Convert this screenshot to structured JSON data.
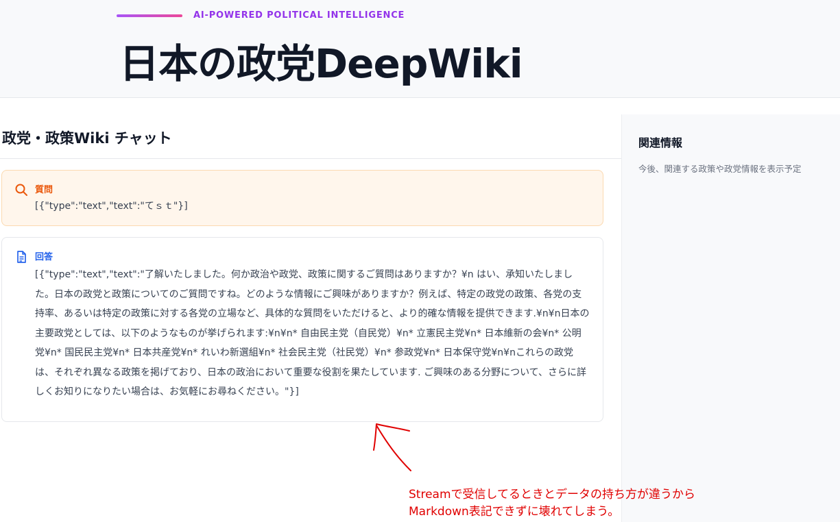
{
  "header": {
    "tagline": "AI-POWERED POLITICAL INTELLIGENCE",
    "title": "日本の政党DeepWiki"
  },
  "chat": {
    "title": "政党・政策Wiki チャット",
    "question": {
      "label": "質問",
      "icon": "search-icon",
      "text": "[{\"type\":\"text\",\"text\":\"てｓｔ\"}]"
    },
    "answer": {
      "label": "回答",
      "icon": "document-icon",
      "text": "[{\"type\":\"text\",\"text\":\"了解いたしました。何か政治や政党、政策に関するご質問はありますか？¥n はい、承知いたしました。日本の政党と政策についてのご質問ですね。どのような情報にご興味がありますか？例えば、特定の政党の政策、各党の支持率、あるいは特定の政策に対する各党の立場など、具体的な質問をいただけると、より的確な情報を提供できます.¥n¥n日本の主要政党としては、以下のようなものが挙げられます:¥n¥n* 自由民主党（自民党）¥n* 立憲民主党¥n* 日本維新の会¥n* 公明党¥n* 国民民主党¥n* 日本共産党¥n* れいわ新選組¥n* 社会民主党（社民党）¥n* 参政党¥n* 日本保守党¥n¥nこれらの政党は、それぞれ異なる政策を掲げており、日本の政治において重要な役割を果たしています. ご興味のある分野について、さらに詳しくお知りになりたい場合は、お気軽にお尋ねください。\"}]"
    }
  },
  "sidebar": {
    "title": "関連情報",
    "description": "今後、関連する政策や政党情報を表示予定"
  },
  "annotation": {
    "line1": "Streamで受信してるときとデータの持ち方が違うから",
    "line2": "Markdown表記できずに壊れてしまう。",
    "color": "#e00000"
  },
  "colors": {
    "accent_gradient_start": "#a855f7",
    "accent_gradient_end": "#ec4899",
    "tagline": "#9333ea",
    "question_label": "#ea580c",
    "answer_label": "#2563eb"
  }
}
